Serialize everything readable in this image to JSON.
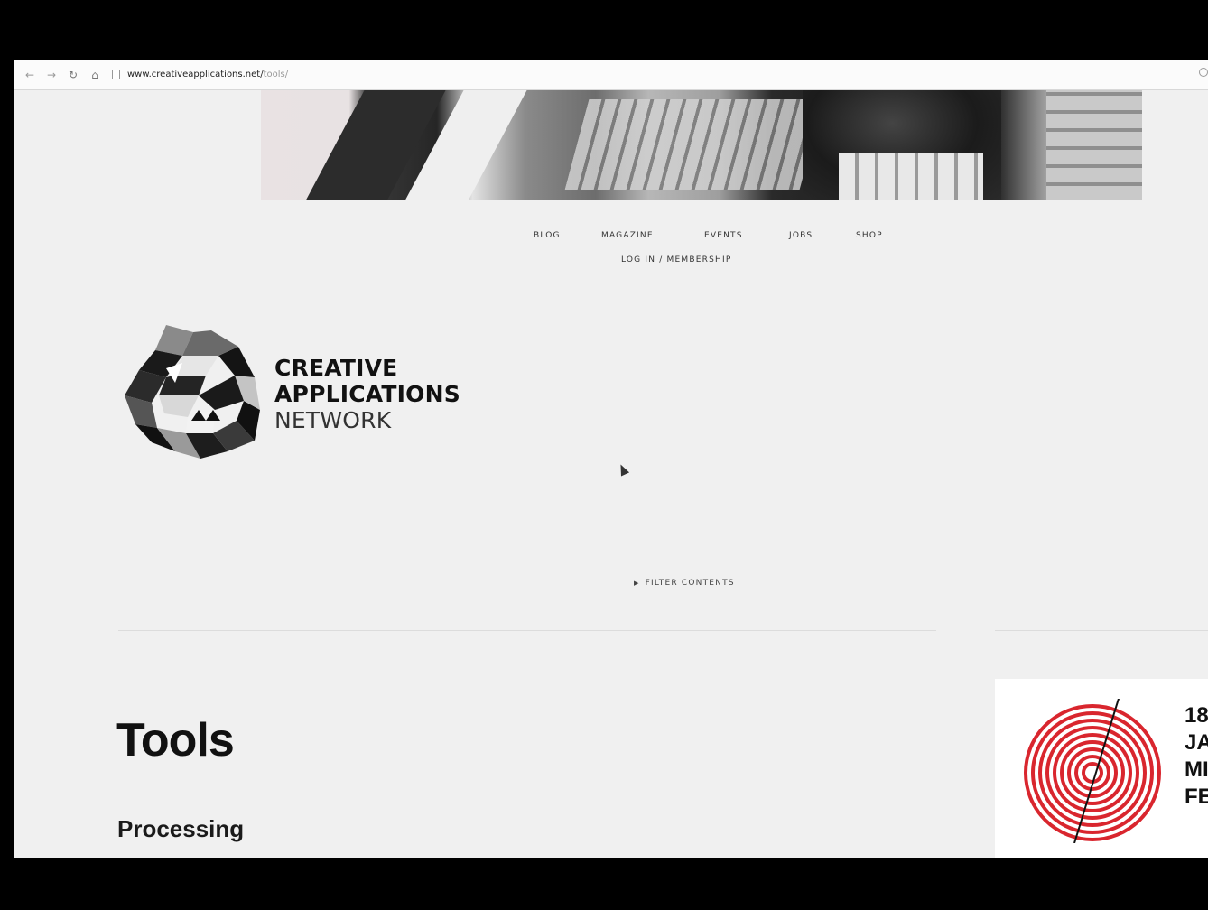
{
  "browser": {
    "url_host": "www.creativeapplications.net/",
    "url_path": "tools/"
  },
  "nav": {
    "items": [
      {
        "label": "BLOG"
      },
      {
        "label": "MAGAZINE"
      },
      {
        "label": "EVENTS"
      },
      {
        "label": "JOBS"
      },
      {
        "label": "SHOP"
      }
    ],
    "member_link": "LOG IN / MEMBERSHIP"
  },
  "logo": {
    "line1": "CREATIVE",
    "line2": "APPLICATIONS",
    "line3": "NETWORK"
  },
  "filter": {
    "label": "FILTER CONTENTS"
  },
  "main": {
    "title": "Tools",
    "subtitle": "Processing"
  },
  "ad": {
    "lines": [
      "18",
      "JA",
      "MI",
      "FE"
    ]
  },
  "colors": {
    "page_bg": "#f0f0f0",
    "ad_accent": "#d9262e"
  }
}
